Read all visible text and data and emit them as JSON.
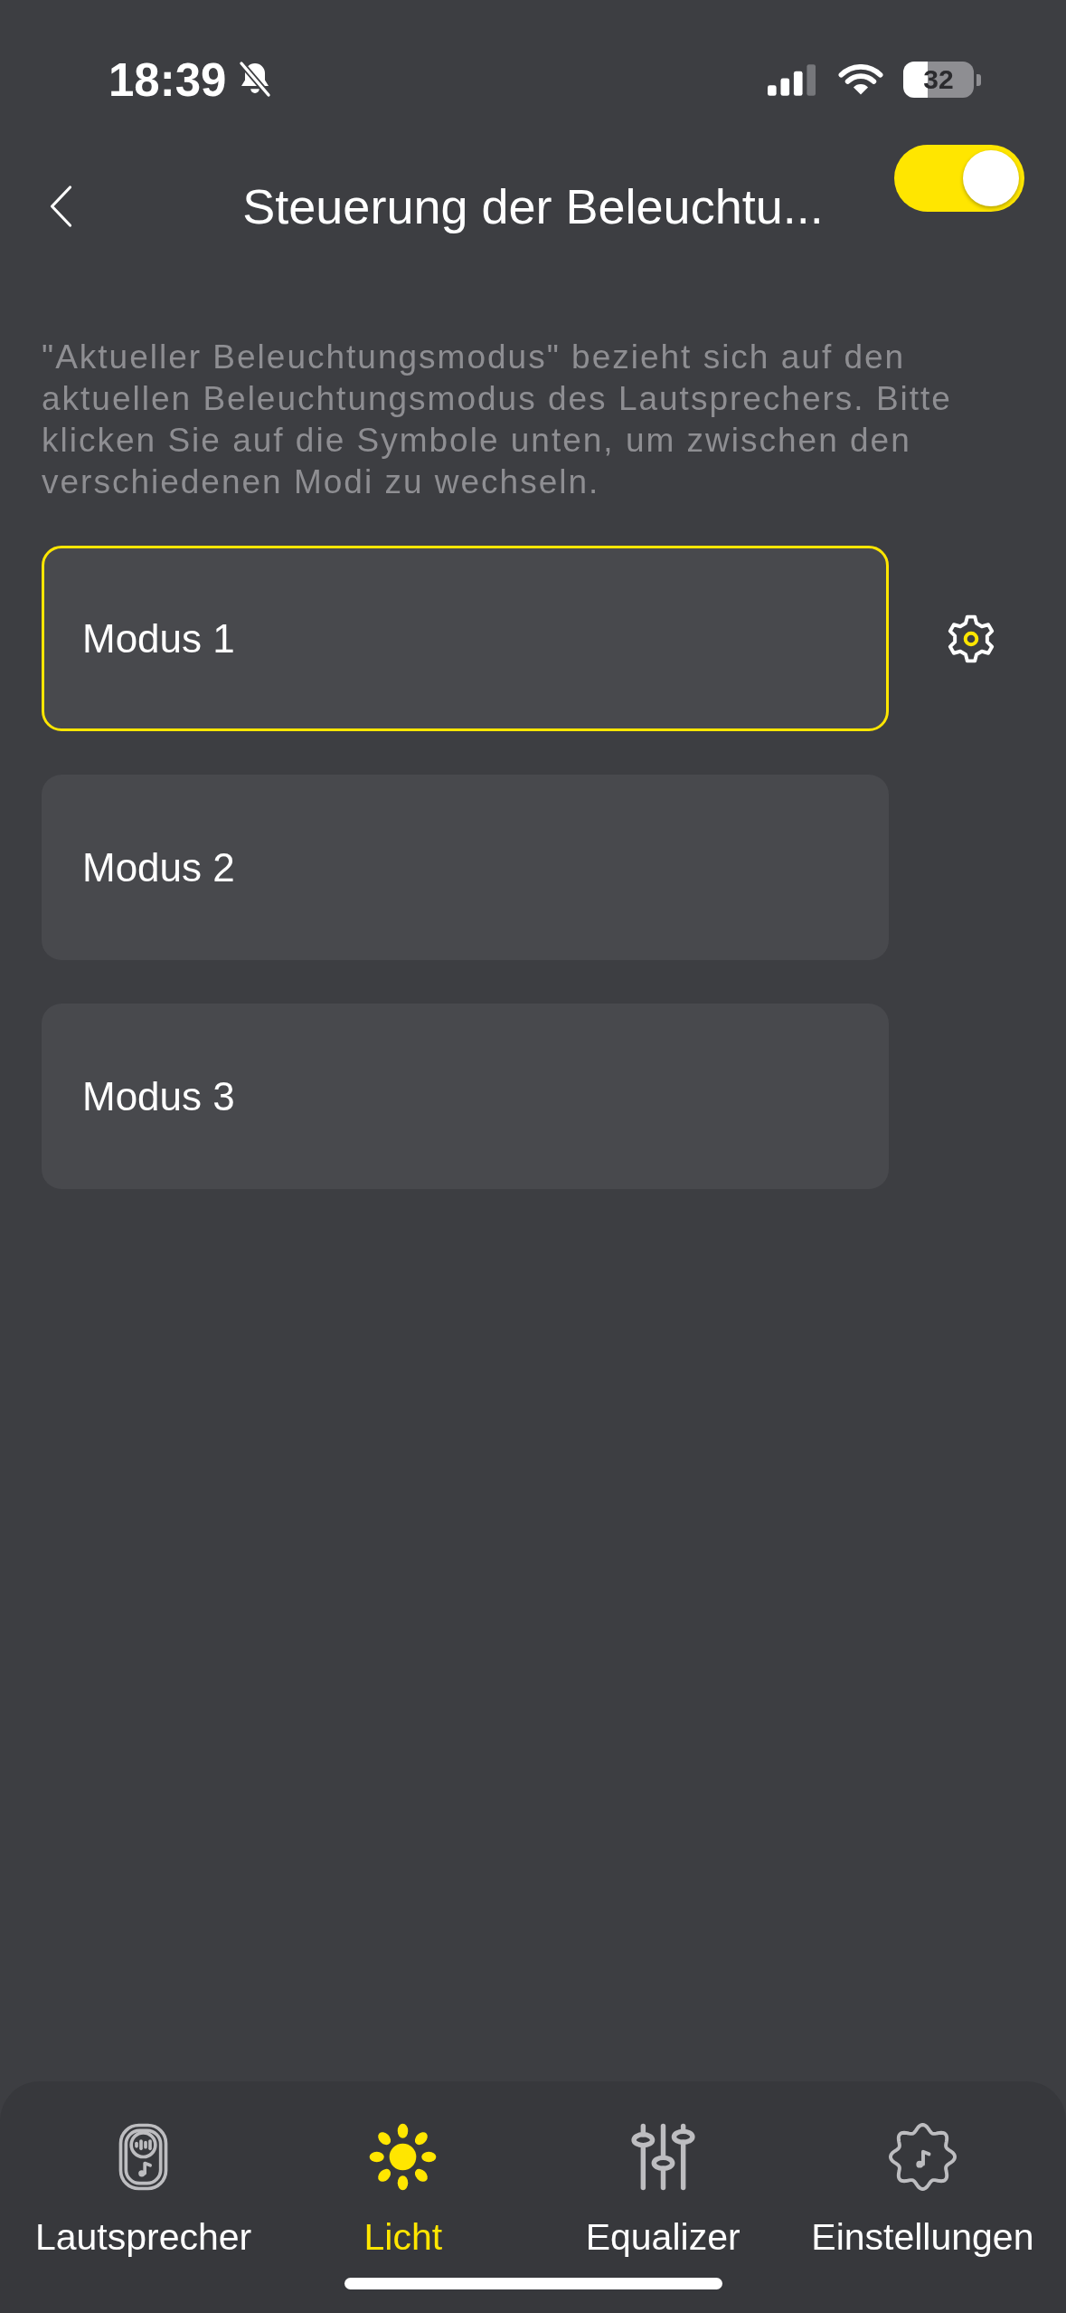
{
  "status_bar": {
    "time": "18:39",
    "battery": "32"
  },
  "header": {
    "title": "Steuerung der Beleuchtu...",
    "toggle": {
      "on": true
    }
  },
  "description": "\"Aktueller Beleuchtungsmodus\" bezieht sich auf den aktuellen Beleuchtungsmodus des Lautsprechers. Bitte klicken Sie auf die Symbole unten, um zwischen den verschiedenen Modi zu wechseln.",
  "modes": [
    {
      "label": "Modus 1",
      "selected": true
    },
    {
      "label": "Modus 2",
      "selected": false
    },
    {
      "label": "Modus 3",
      "selected": false
    }
  ],
  "tab_bar": [
    {
      "label": "Lautsprecher",
      "selected": false
    },
    {
      "label": "Licht",
      "selected": true
    },
    {
      "label": "Equalizer",
      "selected": false
    },
    {
      "label": "Einstellungen",
      "selected": false
    }
  ]
}
